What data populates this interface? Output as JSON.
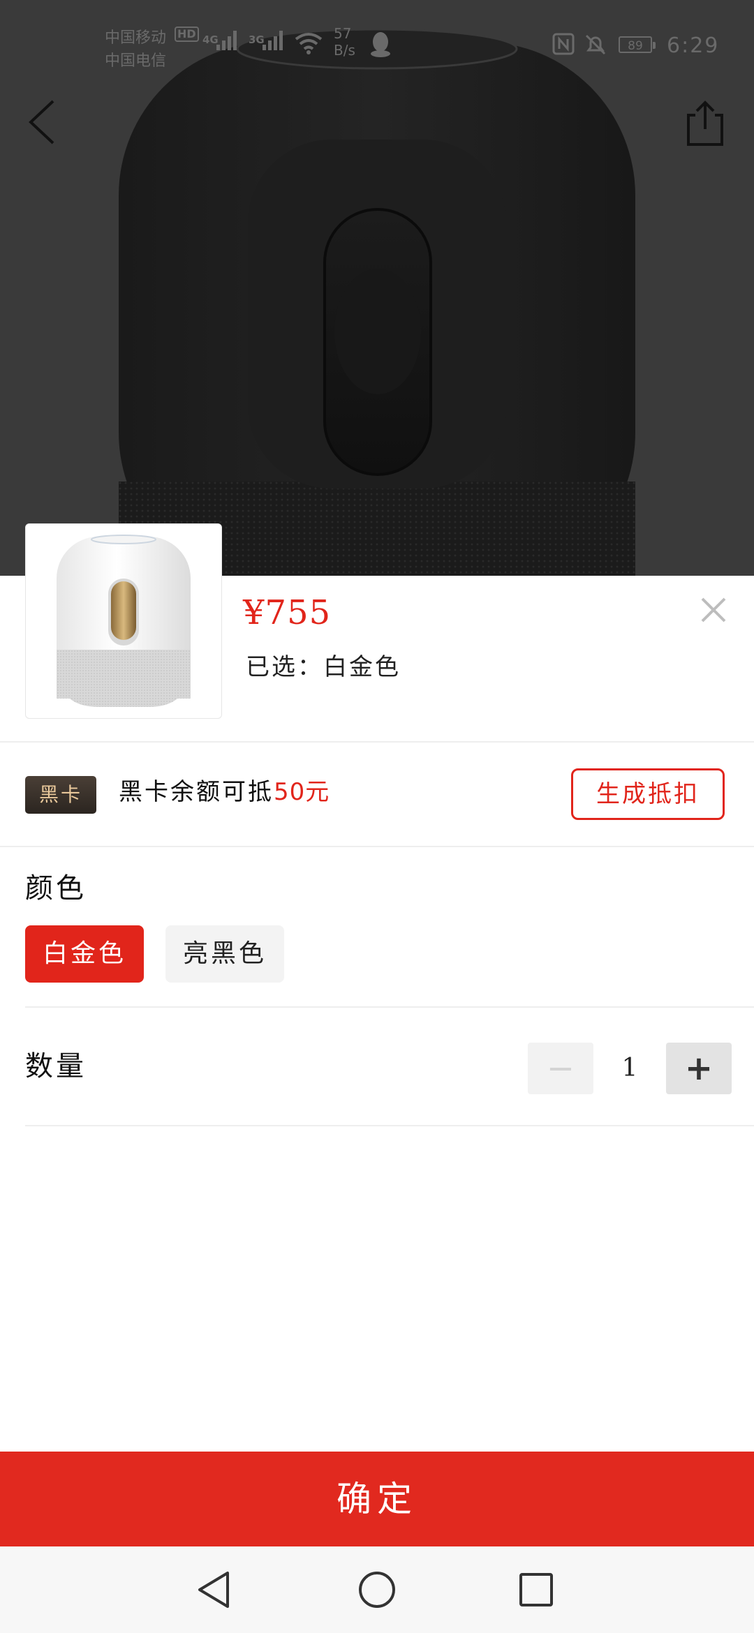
{
  "status_bar": {
    "carrier_1": "中国移动",
    "carrier_2": "中国电信",
    "hd_label": "HD",
    "network_1": "4G",
    "network_2": "3G",
    "speed_value": "57",
    "speed_unit": "B/s",
    "battery": "89",
    "time": "6:29"
  },
  "product": {
    "price": "¥755",
    "selected_label": "已选：",
    "selected_value": "白金色"
  },
  "heika": {
    "badge": "黑卡",
    "text": "黑卡余额可抵",
    "amount": "50元",
    "button": "生成抵扣"
  },
  "color_section": {
    "title": "颜色",
    "options": [
      {
        "label": "白金色",
        "selected": true
      },
      {
        "label": "亮黑色",
        "selected": false
      }
    ]
  },
  "quantity_section": {
    "title": "数量",
    "minus": "−",
    "value": "1",
    "plus": "+"
  },
  "confirm_button": "确定",
  "icons": {
    "back": "back-arrow-icon",
    "share": "share-icon",
    "close": "close-icon",
    "nav_back": "nav-back-icon",
    "nav_home": "nav-home-icon",
    "nav_recents": "nav-recents-icon"
  },
  "colors": {
    "accent": "#e1251b",
    "overlay": "#3a3a3a",
    "heika_gold": "#e8c79a"
  }
}
